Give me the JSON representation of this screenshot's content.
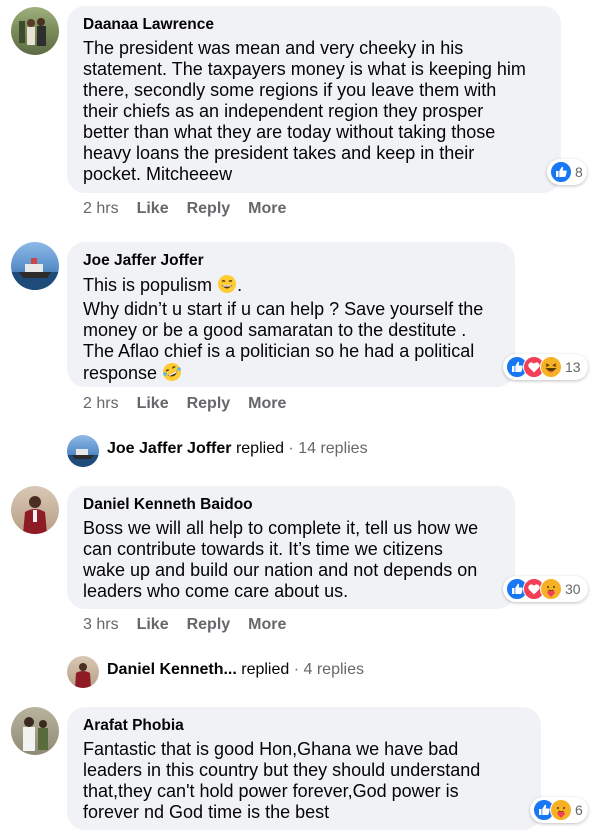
{
  "comments": [
    {
      "author": "Daanaa Lawrence",
      "text": "The president was mean and very cheeky in his\nstatement. The taxpayers money is what is keeping him\nthere, secondly some regions if you leave them with\ntheir chiefs as an independent region they prosper\nbetter than what they are today without taking those\nheavy loans the president takes and keep in their\npocket. Mitcheeew",
      "reaction_count": "8",
      "reactions": [
        "like-icon"
      ],
      "time": "2 hrs",
      "like": "Like",
      "reply": "Reply",
      "more": "More"
    },
    {
      "author": "Joe Jaffer Joffer",
      "text_line1": "This is populism",
      "text_line1_end": ".",
      "text_mid": "Why didn’t u start if u can help ? Save yourself the\nmoney or be a good samaratan to the destitute .\nThe Aflao chief is a politician so he had a political",
      "text_last": "response",
      "reaction_count": "13",
      "reactions": [
        "like-icon",
        "love-icon",
        "haha-icon"
      ],
      "time": "2 hrs",
      "like": "Like",
      "reply": "Reply",
      "more": "More",
      "replied_name": "Joe Jaffer Joffer",
      "replied_word": "replied",
      "replied_count": "14 replies"
    },
    {
      "author": "Daniel Kenneth Baidoo",
      "text": "Boss we will all help to complete it, tell us how we\ncan contribute towards it. It’s time we citizens\nwake up and build our nation and not depends on\nleaders who come care about us.",
      "reaction_count": "30",
      "reactions": [
        "like-icon",
        "love-icon",
        "care-icon"
      ],
      "time": "3 hrs",
      "like": "Like",
      "reply": "Reply",
      "more": "More",
      "replied_name": "Daniel Kenneth...",
      "replied_word": "replied",
      "replied_count": "4 replies"
    },
    {
      "author": "Arafat Phobia",
      "text": "Fantastic that is good Hon,Ghana we have bad\nleaders in this country but they should understand\nthat,they can't hold power forever,God power is\nforever nd God time is the best",
      "reaction_count": "6",
      "reactions": [
        "like-icon",
        "care-icon"
      ],
      "time": "",
      "like": "",
      "reply": "",
      "more": ""
    }
  ],
  "colors": {
    "bubble": "#f0f2f5",
    "like": "#1877f2",
    "love": "#f33e58",
    "haha": "#f7b125",
    "secondary_text": "#65676b"
  }
}
